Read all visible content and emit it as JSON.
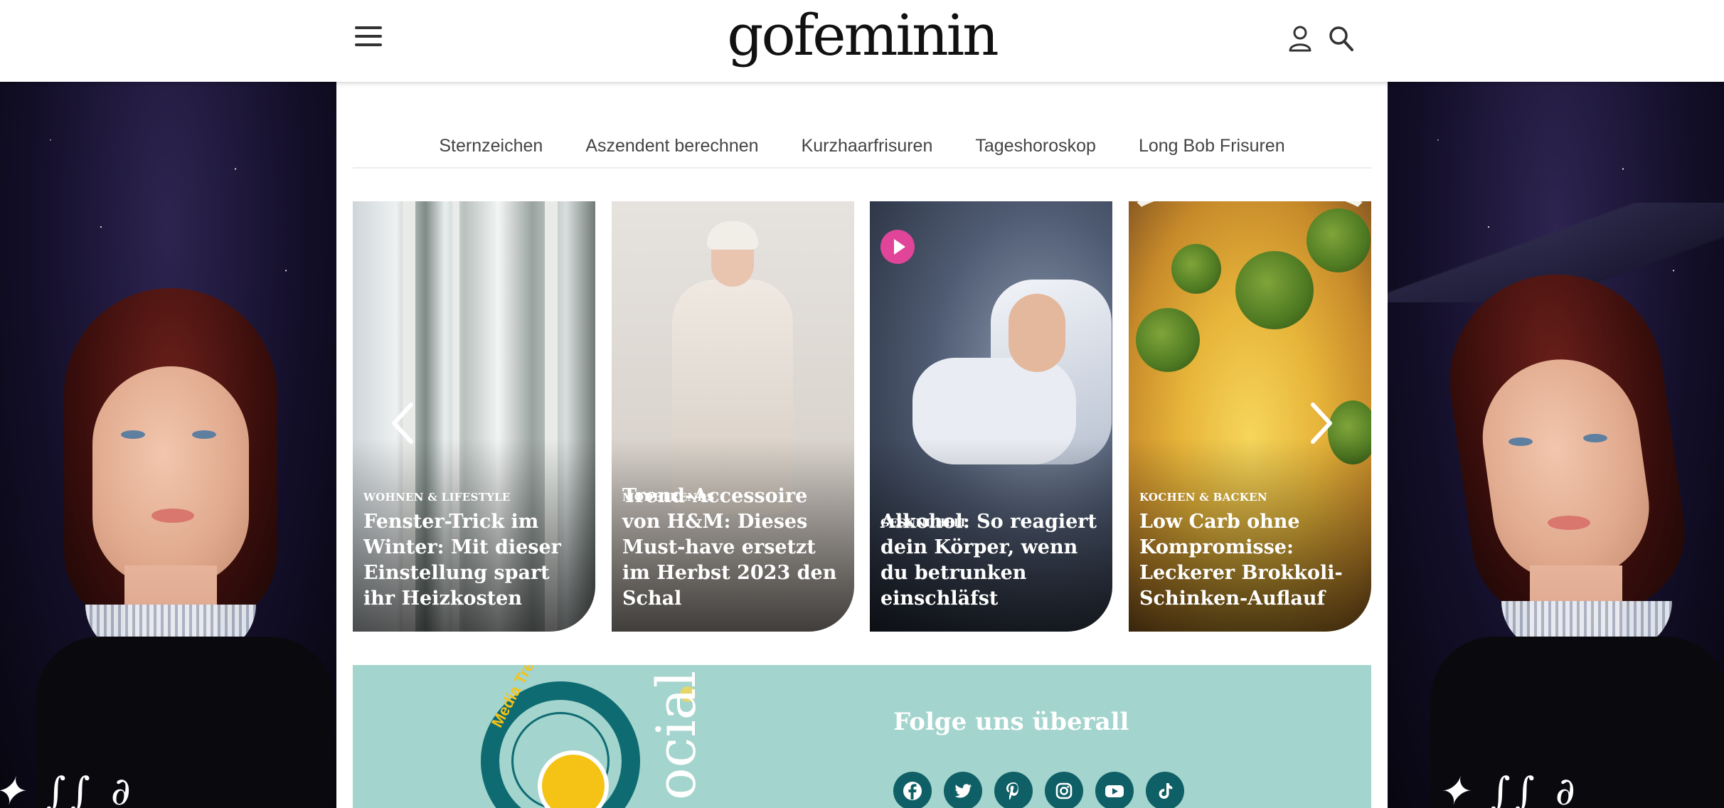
{
  "header": {
    "logo": "gofeminin",
    "menu_icon": "hamburger-menu-icon",
    "user_icon": "user-icon",
    "search_icon": "search-icon"
  },
  "tag_nav": [
    {
      "label": "Sternzeichen"
    },
    {
      "label": "Aszendent berechnen"
    },
    {
      "label": "Kurzhaarfrisuren"
    },
    {
      "label": "Tageshoroskop"
    },
    {
      "label": "Long Bob Frisuren"
    }
  ],
  "carousel": {
    "prev_icon": "chevron-left-icon",
    "next_icon": "chevron-right-icon",
    "cards": [
      {
        "category": "WOHNEN & LIFESTYLE",
        "title": "Fenster-Trick im Winter: Mit dieser Einstellung spart ihr Heizkosten",
        "has_video": false
      },
      {
        "category": "MODETRENDS",
        "title": "Trend-Accessoire von H&M: Dieses Must-have ersetzt im Herbst 2023 den Schal",
        "has_video": false
      },
      {
        "category": "GESUNDHEIT",
        "title": "Alkohol: So reagiert dein Körper, wenn du betrunken einschläfst",
        "has_video": true
      },
      {
        "category": "KOCHEN & BACKEN",
        "title": "Low Carb ohne Kompromisse: Leckerer Brokkoli-Schinken-Auflauf",
        "has_video": false
      }
    ]
  },
  "social_banner": {
    "ring_text": "Media Trends",
    "social_word": "ocial",
    "follow_text": "Folge uns überall",
    "icons": [
      "facebook-icon",
      "twitter-icon",
      "pinterest-icon",
      "instagram-icon",
      "youtube-icon",
      "tiktok-icon"
    ],
    "background_color": "#a3d4cd",
    "icon_color": "#0f5f66"
  },
  "colors": {
    "video_badge": "#e0459a",
    "accent_teal": "#0f6b72",
    "accent_yellow": "#f5c316"
  }
}
